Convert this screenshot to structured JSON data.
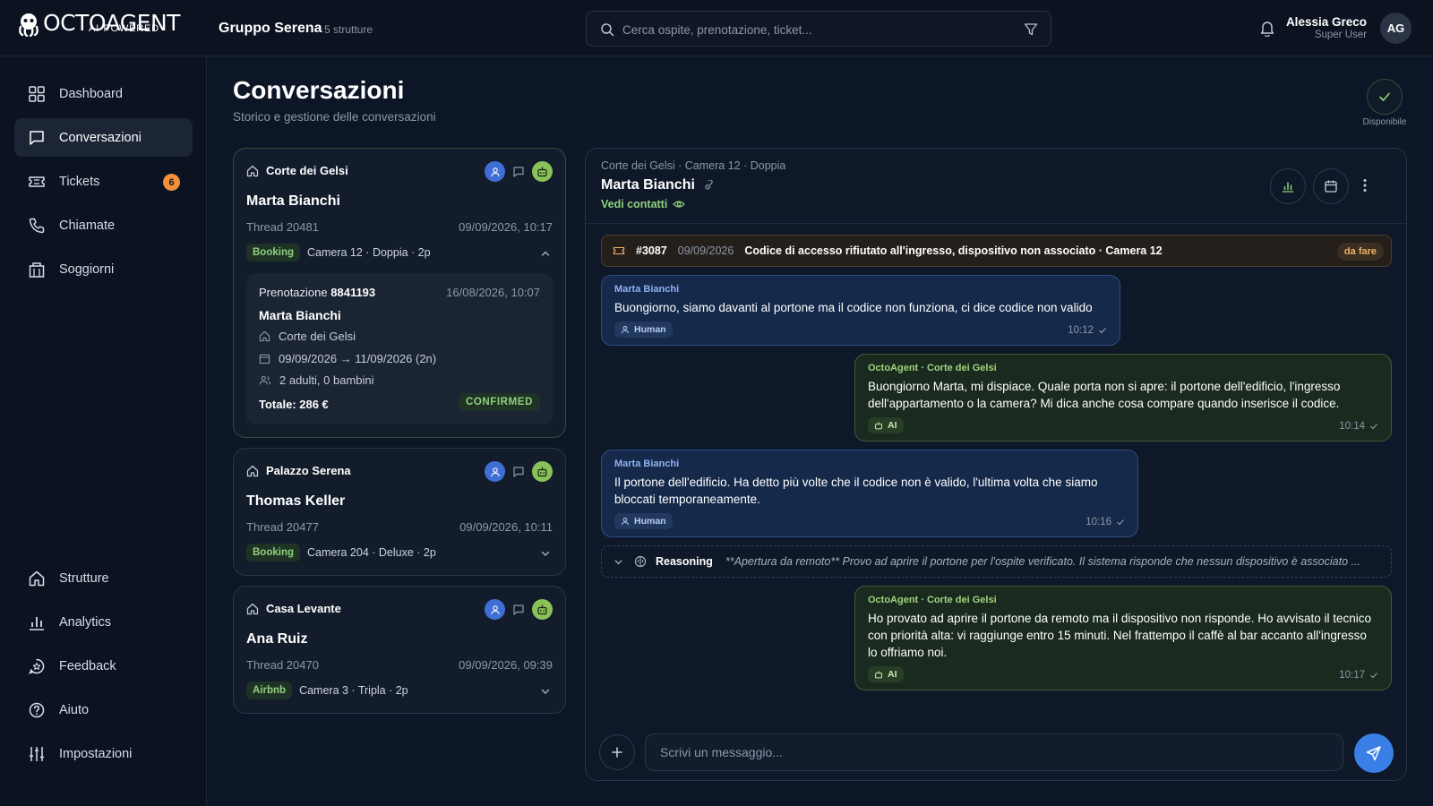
{
  "header": {
    "logo_text": "OCTOAGENT",
    "logo_sub": "AI-POWERED",
    "group_name": "Gruppo Serena",
    "group_count": "5 strutture",
    "search_placeholder": "Cerca ospite, prenotazione, ticket...",
    "user_name": "Alessia Greco",
    "user_role": "Super User",
    "avatar_initials": "AG"
  },
  "sidebar": {
    "items": [
      {
        "label": "Dashboard",
        "icon": "grid-icon"
      },
      {
        "label": "Conversazioni",
        "icon": "chat-icon",
        "active": true
      },
      {
        "label": "Tickets",
        "icon": "ticket-icon",
        "badge": "6"
      },
      {
        "label": "Chiamate",
        "icon": "phone-icon"
      },
      {
        "label": "Soggiorni",
        "icon": "building-icon"
      },
      {
        "label": "Strutture",
        "icon": "home-icon"
      },
      {
        "label": "Analytics",
        "icon": "bar-chart-icon"
      },
      {
        "label": "Feedback",
        "icon": "feedback-icon"
      },
      {
        "label": "Aiuto",
        "icon": "help-icon"
      },
      {
        "label": "Impostazioni",
        "icon": "sliders-icon"
      }
    ]
  },
  "page": {
    "title": "Conversazioni",
    "subtitle": "Storico e gestione delle conversazioni",
    "availability_label": "Disponibile"
  },
  "conversations": [
    {
      "property": "Corte dei Gelsi",
      "guest": "Marta Bianchi",
      "thread": "Thread 20481",
      "datetime": "09/09/2026, 10:17",
      "channel": "Booking",
      "room": "Camera 12 · Doppia · 2p",
      "expanded": true,
      "booking": {
        "label": "Prenotazione",
        "number": "8841193",
        "created": "16/08/2026, 10:07",
        "guest": "Marta Bianchi",
        "property": "Corte dei Gelsi",
        "dates": "09/09/2026 → 11/09/2026 (2n)",
        "guests": "2 adulti, 0 bambini",
        "total": "Totale: 286 €",
        "status": "CONFIRMED"
      }
    },
    {
      "property": "Palazzo Serena",
      "guest": "Thomas Keller",
      "thread": "Thread 20477",
      "datetime": "09/09/2026, 10:11",
      "channel": "Booking",
      "room": "Camera 204 · Deluxe · 2p",
      "expanded": false
    },
    {
      "property": "Casa Levante",
      "guest": "Ana Ruiz",
      "thread": "Thread 20470",
      "datetime": "09/09/2026, 09:39",
      "channel": "Airbnb",
      "room": "Camera 3 · Tripla · 2p",
      "expanded": false
    }
  ],
  "chat": {
    "breadcrumb": "Corte dei Gelsi · Camera 12 · Doppia",
    "guest_name": "Marta Bianchi",
    "contacts_link": "Vedi contatti",
    "ticket": {
      "id": "#3087",
      "date": "09/09/2026",
      "text": "Codice di accesso rifiutato all'ingresso, dispositivo non associato · Camera 12",
      "status": "da fare"
    },
    "messages": [
      {
        "role": "human",
        "sender": "Marta Bianchi",
        "text": "Buongiorno, siamo davanti al portone ma il codice non funziona, ci dice codice non valido",
        "chip": "Human",
        "time": "10:12"
      },
      {
        "role": "ai",
        "sender": "OctoAgent · Corte dei Gelsi",
        "text": "Buongiorno Marta, mi dispiace. Quale porta non si apre: il portone dell'edificio, l'ingresso dell'appartamento o la camera? Mi dica anche cosa compare quando inserisce il codice.",
        "chip": "AI",
        "time": "10:14"
      },
      {
        "role": "human",
        "sender": "Marta Bianchi",
        "text": "Il portone dell'edificio. Ha detto più volte che il codice non è valido, l'ultima volta che siamo bloccati temporaneamente.",
        "chip": "Human",
        "time": "10:16"
      },
      {
        "role": "ai",
        "sender": "OctoAgent · Corte dei Gelsi",
        "text": "Ho provato ad aprire il portone da remoto ma il dispositivo non risponde. Ho avvisato il tecnico con priorità alta: vi raggiunge entro 15 minuti. Nel frattempo il caffè al bar accanto all'ingresso lo offriamo noi.",
        "chip": "AI",
        "time": "10:17"
      }
    ],
    "reasoning": {
      "label": "Reasoning",
      "text": "**Apertura da remoto** Provo ad aprire il portone per l'ospite verificato. Il sistema risponde che nessun dispositivo è associato ..."
    },
    "composer_placeholder": "Scrivi un messaggio..."
  },
  "colors": {
    "background": "#0d1626",
    "accent_green": "#8fd17c",
    "human_blue": "#3f6fd6",
    "ai_green": "#8ac25a",
    "badge_orange": "#f0903a",
    "send_blue": "#3a7fe6"
  }
}
